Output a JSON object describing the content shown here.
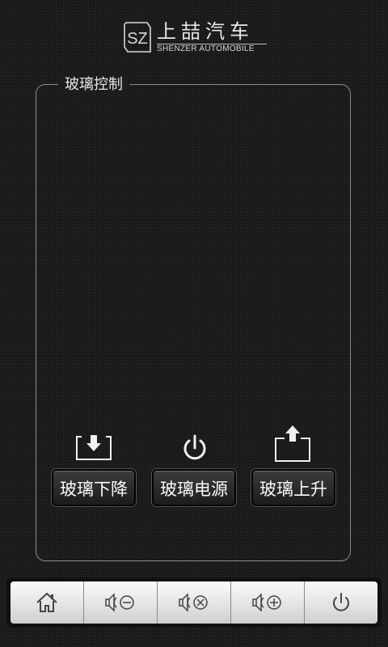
{
  "brand": {
    "name_cn": "上喆汽车",
    "name_en": "SHENZER AUTOMOBILE",
    "mark": "SZ"
  },
  "panel": {
    "title": "玻璃控制"
  },
  "controls": [
    {
      "label": "玻璃下降",
      "icon": "window-down-icon"
    },
    {
      "label": "玻璃电源",
      "icon": "power-icon"
    },
    {
      "label": "玻璃上升",
      "icon": "window-up-icon"
    }
  ],
  "toolbar": {
    "items": [
      {
        "icon": "home-icon"
      },
      {
        "icon": "volume-mute-icon"
      },
      {
        "icon": "volume-off-icon"
      },
      {
        "icon": "volume-up-icon"
      },
      {
        "icon": "power-icon"
      }
    ]
  },
  "colors": {
    "background": "#1e1c1f",
    "panel_border": "#8c8a8e",
    "button_dark": "#2a2a2a",
    "toolbar_light": "#e6e6e6"
  }
}
